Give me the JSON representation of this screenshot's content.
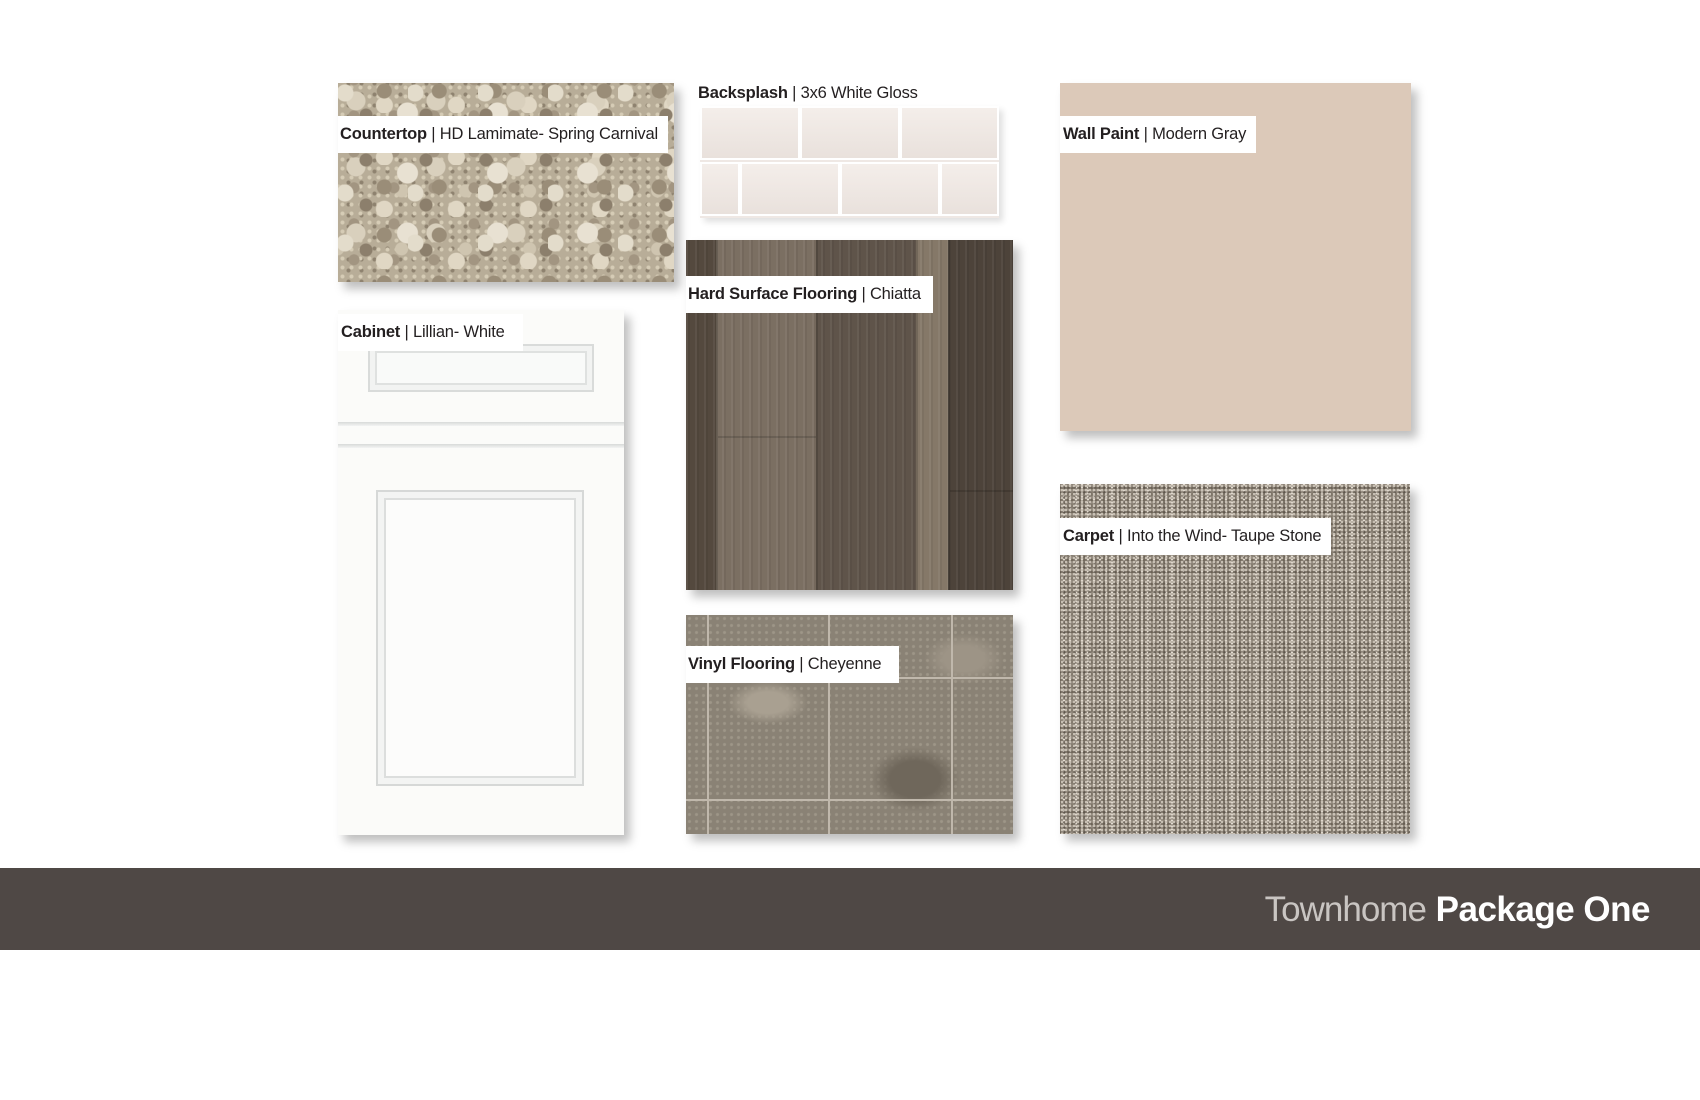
{
  "samples": {
    "countertop": {
      "name": "Countertop",
      "value": "HD Lamimate- Spring Carnival"
    },
    "backsplash": {
      "name": "Backsplash",
      "value": "3x6 White Gloss"
    },
    "wall_paint": {
      "name": "Wall Paint",
      "value": "Modern Gray"
    },
    "hard_surface": {
      "name": "Hard Surface Flooring",
      "value": "Chiatta"
    },
    "cabinet": {
      "name": "Cabinet",
      "value": "Lillian- White"
    },
    "carpet": {
      "name": "Carpet",
      "value": "Into the Wind- Taupe Stone"
    },
    "vinyl": {
      "name": "Vinyl Flooring",
      "value": "Cheyenne"
    }
  },
  "separator": "|",
  "footer": {
    "title_light": "Townhome",
    "title_bold": "Package One"
  },
  "colors": {
    "footer_bg": "#4f4845",
    "wall_paint_swatch": "#dcc9b9",
    "label_text": "#231f20"
  }
}
